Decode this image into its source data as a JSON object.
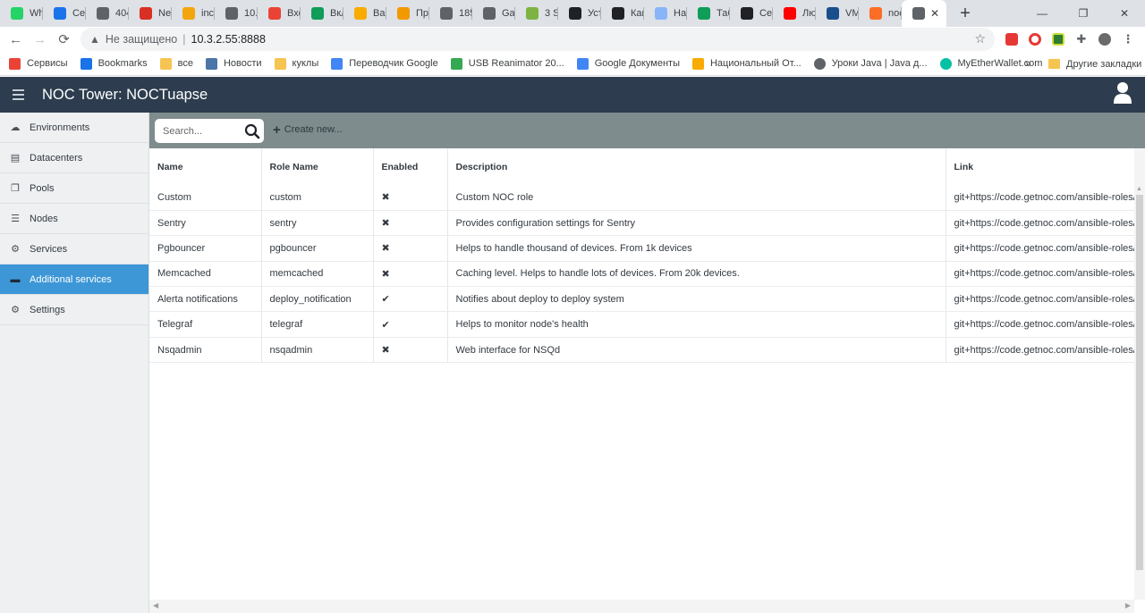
{
  "browser": {
    "tabs": [
      {
        "title": "Wh",
        "icon": "whatsapp-icon",
        "color": "#25d366"
      },
      {
        "title": "Сер",
        "icon": "wave-icon",
        "color": "#1a73e8"
      },
      {
        "title": "404",
        "icon": "globe-icon",
        "color": "#5f6368"
      },
      {
        "title": "Net",
        "icon": "z-icon",
        "color": "#d93025"
      },
      {
        "title": "inc",
        "icon": "mail-icon",
        "color": "#f2a60c"
      },
      {
        "title": "10.",
        "icon": "globe-icon",
        "color": "#5f6368"
      },
      {
        "title": "Вхо",
        "icon": "gmail-icon",
        "color": "#ea4335"
      },
      {
        "title": "Вкл",
        "icon": "sheets-icon",
        "color": "#0f9d58"
      },
      {
        "title": "Вар",
        "icon": "pencil-icon",
        "color": "#f9ab00"
      },
      {
        "title": "Про",
        "icon": "sphere-icon",
        "color": "#f29900"
      },
      {
        "title": "185",
        "icon": "globe-icon",
        "color": "#5f6368"
      },
      {
        "title": "Gar",
        "icon": "globe-icon",
        "color": "#5f6368"
      },
      {
        "title": "3 S",
        "icon": "layers-icon",
        "color": "#7cb342"
      },
      {
        "title": "Уст",
        "icon": "box-icon",
        "color": "#202124"
      },
      {
        "title": "Как",
        "icon": "box-icon",
        "color": "#202124"
      },
      {
        "title": "Нас",
        "icon": "flask-icon",
        "color": "#8ab4f8"
      },
      {
        "title": "Таб",
        "icon": "sheets-icon",
        "color": "#0f9d58"
      },
      {
        "title": "Сег",
        "icon": "helmet-icon",
        "color": "#202124"
      },
      {
        "title": "Лю",
        "icon": "youtube-icon",
        "color": "#ff0000"
      },
      {
        "title": "VM",
        "icon": "ru-icon",
        "color": "#1a4f8b"
      },
      {
        "title": "noc",
        "icon": "gitlab-icon",
        "color": "#fc6d26"
      },
      {
        "title": "",
        "icon": "noc-icon",
        "color": "#5f6368",
        "active": true
      }
    ],
    "new_tab": "+",
    "window_controls": {
      "minimize": "—",
      "maximize": "❐",
      "close": "✕"
    },
    "nav": {
      "back": "←",
      "forward": "→",
      "reload": "⟳"
    },
    "security_text": "Не защищено",
    "url": "10.3.2.55:8888",
    "bookmarks": [
      {
        "label": "Сервисы",
        "icon": "apps-icon"
      },
      {
        "label": "Bookmarks",
        "icon": "star-icon"
      },
      {
        "label": "все",
        "icon": "folder-icon"
      },
      {
        "label": "Новости",
        "icon": "vk-icon"
      },
      {
        "label": "куклы",
        "icon": "folder-icon"
      },
      {
        "label": "Переводчик Google",
        "icon": "translate-icon"
      },
      {
        "label": "USB Reanimator 20...",
        "icon": "leaf-icon"
      },
      {
        "label": "Google Документы",
        "icon": "docs-icon"
      },
      {
        "label": "Национальный От...",
        "icon": "lightbulb-icon"
      },
      {
        "label": "Уроки Java | Java д...",
        "icon": "globe-icon"
      },
      {
        "label": "MyEtherWallet.com",
        "icon": "wallet-icon"
      }
    ],
    "bookmarks_more": "»",
    "other_bookmarks": "Другие закладки"
  },
  "app": {
    "title": "NOC Tower: NOCTuapse",
    "sidebar": [
      {
        "label": "Environments",
        "icon": "cloud-icon"
      },
      {
        "label": "Datacenters",
        "icon": "building-icon"
      },
      {
        "label": "Pools",
        "icon": "copy-icon"
      },
      {
        "label": "Nodes",
        "icon": "server-icon"
      },
      {
        "label": "Services",
        "icon": "cogs-icon"
      },
      {
        "label": "Additional services",
        "icon": "folder-icon",
        "active": true
      },
      {
        "label": "Settings",
        "icon": "gear-icon"
      }
    ],
    "search_placeholder": "Search...",
    "create_label": "Create new...",
    "columns": [
      "Name",
      "Role Name",
      "Enabled",
      "Description",
      "Link"
    ],
    "rows": [
      {
        "name": "Custom",
        "role": "custom",
        "enabled": "✖",
        "description": "Custom NOC role",
        "link": "git+https://code.getnoc.com/ansible-roles/a"
      },
      {
        "name": "Sentry",
        "role": "sentry",
        "enabled": "✖",
        "description": "Provides configuration settings for Sentry",
        "link": "git+https://code.getnoc.com/ansible-roles/a"
      },
      {
        "name": "Pgbouncer",
        "role": "pgbouncer",
        "enabled": "✖",
        "description": "Helps to handle thousand of devices. From 1k devices",
        "link": "git+https://code.getnoc.com/ansible-roles/a"
      },
      {
        "name": "Memcached",
        "role": "memcached",
        "enabled": "✖",
        "description": "Caching level. Helps to handle lots of devices. From 20k devices.",
        "link": "git+https://code.getnoc.com/ansible-roles/a"
      },
      {
        "name": "Alerta notifications",
        "role": "deploy_notification",
        "enabled": "✔",
        "description": "Notifies about deploy to deploy system",
        "link": "git+https://code.getnoc.com/ansible-roles/a"
      },
      {
        "name": "Telegraf",
        "role": "telegraf",
        "enabled": "✔",
        "description": "Helps to monitor node's health",
        "link": "git+https://code.getnoc.com/ansible-roles/a"
      },
      {
        "name": "Nsqadmin",
        "role": "nsqadmin",
        "enabled": "✖",
        "description": "Web interface for NSQd",
        "link": "git+https://code.getnoc.com/ansible-roles/a"
      }
    ]
  }
}
